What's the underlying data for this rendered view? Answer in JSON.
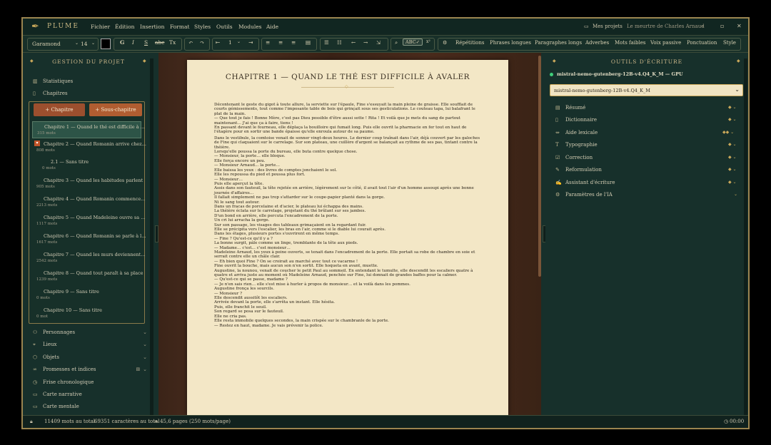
{
  "app": {
    "brand": "PLUME"
  },
  "menu": [
    "Fichier",
    "Édition",
    "Insertion",
    "Format",
    "Styles",
    "Outils",
    "Modules",
    "Aide"
  ],
  "topright": {
    "projects": "Mes projets",
    "doc": "Le meurtre de Charles Arnaud"
  },
  "toolbar": {
    "font": "Garamond",
    "size": "14",
    "bold": "G",
    "italic": "I",
    "underline": "S",
    "strike": "abc",
    "tx": "Tx",
    "spacing": "1",
    "spell": "ABC✓",
    "btns": [
      "Répétitions",
      "Phrases longues",
      "Paragraphes longs",
      "Adverbes",
      "Mots faibles",
      "Voix passive",
      "Ponctuation",
      "Style"
    ]
  },
  "left": {
    "title": "GESTION DU PROJET",
    "nav_top": [
      {
        "icon": "chart-icon",
        "label": "Statistiques"
      },
      {
        "icon": "book-icon",
        "label": "Chapitres"
      }
    ],
    "btn_chap": "+ Chapitre",
    "btn_sub": "+ Sous-chapitre",
    "chapters": [
      {
        "title": "Chapitre 1 — Quand le thé est difficile à ...",
        "mw": "315 mots"
      },
      {
        "title": "Chapitre 2 — Quand Romanin arrive chez...",
        "mw": "808 mots"
      },
      {
        "title": "2.1 — Sans titre",
        "mw": "0 mots"
      },
      {
        "title": "Chapitre 3 — Quand les habitudes parlent",
        "mw": "905 mots"
      },
      {
        "title": "Chapitre 4 — Quand Romanin commence...",
        "mw": "2213 mots"
      },
      {
        "title": "Chapitre 5 — Quand Madeleine ouvre sa ...",
        "mw": "1117 mots"
      },
      {
        "title": "Chapitre 6 — Quand Romanin se parle à l...",
        "mw": "1617 mots"
      },
      {
        "title": "Chapitre 7 — Quand les murs deviennent...",
        "mw": "2542 mots"
      },
      {
        "title": "Chapitre 8 — Quand tout paraît à sa place",
        "mw": "1239 mots"
      },
      {
        "title": "Chapitre 9 — Sans titre",
        "mw": "0 mots"
      },
      {
        "title": "Chapitre 10 — Sans titre",
        "mw": "0 mot"
      }
    ],
    "nav_bottom": [
      {
        "icon": "person-icon",
        "label": "Personnages"
      },
      {
        "icon": "pin-icon",
        "label": "Lieux"
      },
      {
        "icon": "box-icon",
        "label": "Objets"
      },
      {
        "icon": "link-icon",
        "label": "Promesses et indices"
      },
      {
        "icon": "clock-icon",
        "label": "Frise chronologique"
      },
      {
        "icon": "map-icon",
        "label": "Carte narrative"
      },
      {
        "icon": "brain-icon",
        "label": "Carte mentale"
      }
    ]
  },
  "page": {
    "title": "CHAPITRE 1 — QUAND LE THÉ EST DIFFICILE À AVALER",
    "paragraphs": [
      "Décontenant le geste du gigot à toute allure, la serviette sur l'épaule, Fine s'essuyait la main pleine de graisse. Elle soufflait de courts gémissements, tout comme l'imposante table de bois qui grinçait sous ses gesticulations. Le couteau tapa, lui balafrant le plat de la main.",
      "— Que tout je fais ! Bonne Mère, c'est pas Dieu possible d'être aussi sotte ! Rita ! Et voilà que je mets du sang de partout maintenant… J'ai que ça à faire, tiens !",
      "En passant devant le fourneau, elle déplaça la bouilloire qui fumait long. Puis elle ouvrit la pharmacie en fer tout en haut de l'étagère pour en sortir une bande épaisse qu'elle enroula autour de sa paume.",
      "Dans le vestibule, la comtoise venait de sonner vingt-deux heures. Le dernier coup traînait dans l'air, déjà couvert par les galoches de Fine qui claquaient sur le carrelage. Sur son plateau, une cuillère d'argent se balançait au rythme de ses pas, tintant contre la théière.",
      "Lorsqu'elle poussa la porte du bureau, elle buta contre quelque chose.",
      "— Monsieur, la porte… elle bloque.",
      "Elle força encore un peu.",
      "— Monsieur Arnaud… la porte…",
      "Elle baissa les yeux : des livres de comptes jonchaient le sol.",
      "Elle les repoussa du pied et poussa plus fort.",
      "— Monsieur…",
      "Puis elle aperçut la tête.",
      "Assis dans son fauteuil, la tête rejetée en arrière, légèrement sur le côté, il avait tout l'air d'un homme assoupi après une bonne journée d'affaires…",
      "Il fallait simplement ne pas trop s'attarder sur le coupe-papier planté dans la gorge.",
      "Ni le sang tout autour.",
      "Dans un fracas de porcelaine et d'acier, le plateau lui échappa des mains.",
      "La théière éclata sur le carrelage, projetant du thé brûlant sur ses jambes.",
      "D'un bond en arrière, elle percuta l'encadrement de la porte.",
      "Un cri lui arracha la gorge.",
      "Sur son passage, les visages des tableaux grimaçaient en la regardant fuir.",
      "Elle se précipita vers l'escalier, les bras en l'air, comme si le diable lui courait après.",
      "Dans les étages, plusieurs portes s'ouvrirent en même temps.",
      "— Fine ? Qu'est-ce qu'il y a ?",
      "La bonne surgit, pâle comme un linge, tremblante de la tête aux pieds.",
      "— Madame… c'est… c'est monsieur…",
      "Madeleine Arnaud, les yeux à peine ouverts, se tenait dans l'encadrement de la porte. Elle portait sa robe de chambre en soie et serrait contre elle un châle clair.",
      "— Eh bien quoi Fine ? On se croirait au marché avec tout ce vacarme !",
      "Fine ouvrit la bouche, mais aucun son n'en sortit. Elle hoqueta en avant, muette.",
      "Augustine, la nounou, venait de coucher le petit Paul au sommeil. En entendant le tumulte, elle descendit les escaliers quatre à quatre et arriva juste au moment où Madeleine Arnaud, penchée sur Fine, lui donnait de grandes baffes pour la calmer.",
      "— Qu'est-ce qui se passe, madame ?",
      "— Je n'en sais rien… elle s'est mise à hurler à propos de monsieur… et la voilà dans les pommes.",
      "Augustine fronça les sourcils.",
      "— Monsieur ?",
      "Elle descendit aussitôt les escaliers.",
      "Arrivée devant la porte, elle s'arrêta un instant. Elle hésita.",
      "Puis, elle franchit le seuil.",
      "Son regard se posa sur le fauteuil.",
      "Elle ne cria pas.",
      "Elle resta immobile quelques secondes, la main crispée sur le chambranle de la porte.",
      "— Restez en haut, madame. Je vais prévenir la police."
    ]
  },
  "right": {
    "title": "OUTILS D'ÉCRITURE",
    "model_status": "mistral-nemo-gutenberg-12B-v4.Q4_K_M — GPU",
    "model_select": "mistral-nemo-gutenberg-12B-v4.Q4_K_M",
    "tools": [
      {
        "icon": "doc-icon",
        "label": "Résumé"
      },
      {
        "icon": "dictionary-icon",
        "label": "Dictionnaire"
      },
      {
        "icon": "lexicon-icon",
        "label": "Aide lexicale"
      },
      {
        "icon": "type-icon",
        "label": "Typographie"
      },
      {
        "icon": "check-icon",
        "label": "Correction"
      },
      {
        "icon": "pen-icon",
        "label": "Reformulation"
      },
      {
        "icon": "assistant-icon",
        "label": "Assistant d'écriture"
      },
      {
        "icon": "gear-icon",
        "label": "Paramètres de l'IA"
      }
    ]
  },
  "status": {
    "words": "11409 mots au total",
    "chars": "69351 caractères au total",
    "pages": "≈ 45,6 pages (250 mots/page)",
    "timer": "00:00"
  }
}
